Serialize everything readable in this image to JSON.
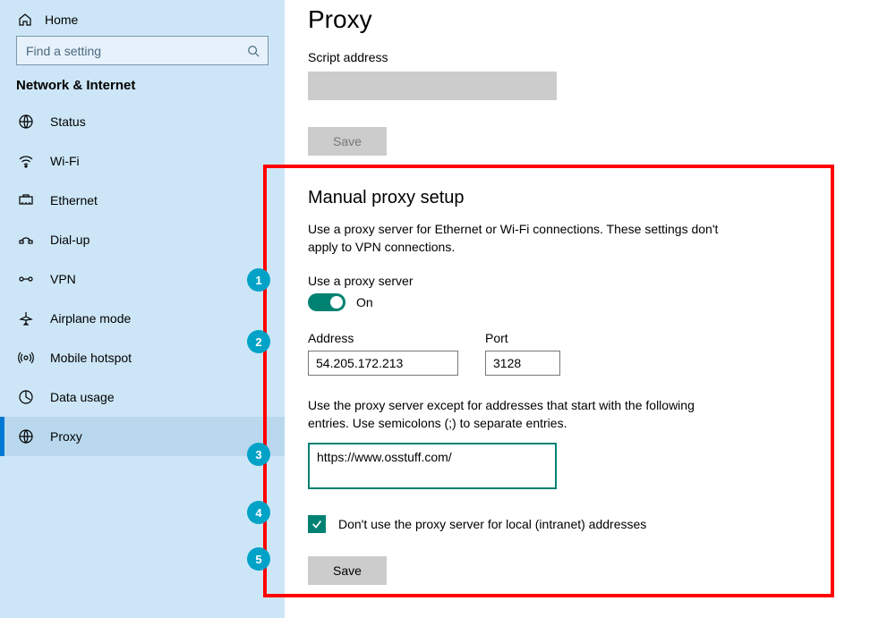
{
  "sidebar": {
    "home": "Home",
    "search_placeholder": "Find a setting",
    "category": "Network & Internet",
    "items": [
      {
        "label": "Status"
      },
      {
        "label": "Wi-Fi"
      },
      {
        "label": "Ethernet"
      },
      {
        "label": "Dial-up"
      },
      {
        "label": "VPN"
      },
      {
        "label": "Airplane mode"
      },
      {
        "label": "Mobile hotspot"
      },
      {
        "label": "Data usage"
      },
      {
        "label": "Proxy"
      }
    ]
  },
  "main": {
    "title": "Proxy",
    "script_address_label": "Script address",
    "script_address_value": "",
    "save_disabled_label": "Save",
    "manual": {
      "title": "Manual proxy setup",
      "desc": "Use a proxy server for Ethernet or Wi-Fi connections. These settings don't apply to VPN connections.",
      "use_proxy_label": "Use a proxy server",
      "toggle_label": "On",
      "address_label": "Address",
      "address_value": "54.205.172.213",
      "port_label": "Port",
      "port_value": "3128",
      "except_desc": "Use the proxy server except for addresses that start with the following entries. Use semicolons (;) to separate entries.",
      "except_value": "https://www.osstuff.com/",
      "local_checkbox_label": "Don't use the proxy server for local (intranet) addresses",
      "save_label": "Save"
    }
  },
  "badges": [
    "1",
    "2",
    "3",
    "4",
    "5"
  ]
}
